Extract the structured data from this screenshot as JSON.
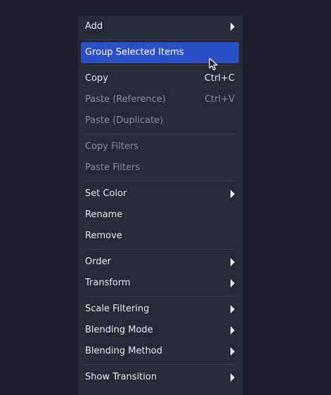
{
  "menu": {
    "add": "Add",
    "group_selected": "Group Selected Items",
    "copy": "Copy",
    "copy_shortcut": "Ctrl+C",
    "paste_reference": "Paste (Reference)",
    "paste_reference_shortcut": "Ctrl+V",
    "paste_duplicate": "Paste (Duplicate)",
    "copy_filters": "Copy Filters",
    "paste_filters": "Paste Filters",
    "set_color": "Set Color",
    "rename": "Rename",
    "remove": "Remove",
    "order": "Order",
    "transform": "Transform",
    "scale_filtering": "Scale Filtering",
    "blending_mode": "Blending Mode",
    "blending_method": "Blending Method",
    "show_transition": "Show Transition"
  },
  "colors": {
    "background": "#1e1f2b",
    "menu_background": "#272a36",
    "highlight": "#2c4fc8",
    "text": "#e8e9ee",
    "disabled_text": "#8b8d98",
    "separator": "#3d404d"
  },
  "icons": {
    "submenu": "submenu-arrow-icon",
    "cursor": "mouse-cursor-icon"
  }
}
